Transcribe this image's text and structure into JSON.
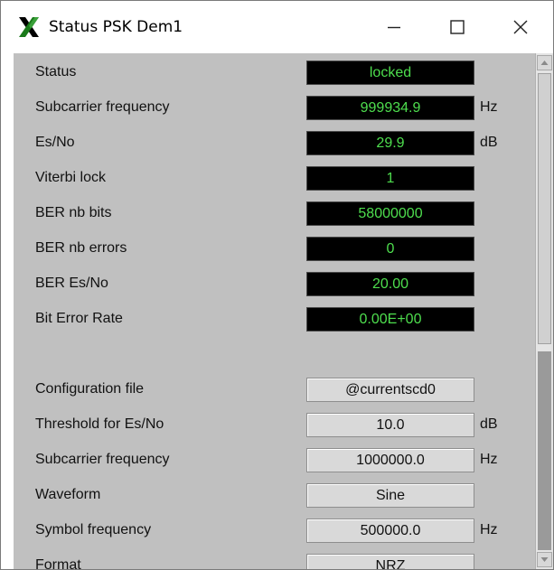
{
  "window": {
    "title": "Status PSK Dem1",
    "icon": "x-app-icon"
  },
  "status_rows": [
    {
      "label": "Status",
      "value": "locked",
      "unit": ""
    },
    {
      "label": "Subcarrier frequency",
      "value": "999934.9",
      "unit": "Hz"
    },
    {
      "label": "Es/No",
      "value": "29.9",
      "unit": "dB"
    },
    {
      "label": "Viterbi lock",
      "value": "1",
      "unit": ""
    },
    {
      "label": "BER nb bits",
      "value": "58000000",
      "unit": ""
    },
    {
      "label": "BER nb errors",
      "value": "0",
      "unit": ""
    },
    {
      "label": "BER Es/No",
      "value": "20.00",
      "unit": ""
    },
    {
      "label": "Bit Error Rate",
      "value": "0.00E+00",
      "unit": ""
    }
  ],
  "config_rows": [
    {
      "label": "Configuration file",
      "value": "@currentscd0",
      "unit": ""
    },
    {
      "label": "Threshold for Es/No",
      "value": "10.0",
      "unit": "dB"
    },
    {
      "label": "Subcarrier frequency",
      "value": "1000000.0",
      "unit": "Hz"
    },
    {
      "label": "Waveform",
      "value": "Sine",
      "unit": ""
    },
    {
      "label": "Symbol frequency",
      "value": "500000.0",
      "unit": "Hz"
    },
    {
      "label": "Format",
      "value": "NRZ",
      "unit": ""
    }
  ],
  "colors": {
    "status_text": "#4ede4e",
    "status_bg": "#000000",
    "panel_bg": "#c0c0c0"
  }
}
